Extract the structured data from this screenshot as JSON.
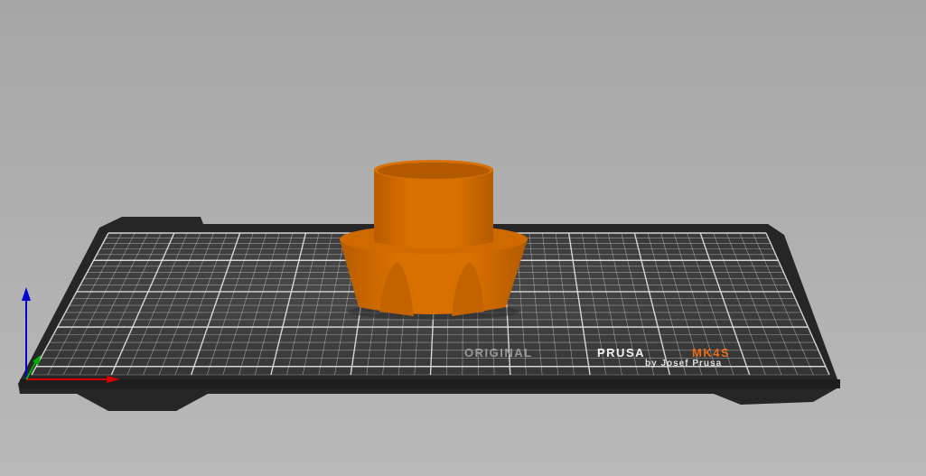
{
  "viewport": {
    "bed_logo": {
      "brand_prefix": "ORIGINAL",
      "brand_name": "PRUSA",
      "model": "MK4S",
      "subtitle": "by Josef Prusa"
    },
    "colors": {
      "background_top": "#a6a6a6",
      "background_bottom": "#b9b9b9",
      "bed": "#2b2b2b",
      "bed_surface": "#3d3d3d",
      "grid": "#e6e6e6",
      "object": "#d56d00",
      "object_shadow": "#a85500",
      "axis_x": "#d00000",
      "axis_y": "#00b000",
      "axis_z": "#0000d0",
      "logo_model": "#ec6b16"
    }
  }
}
